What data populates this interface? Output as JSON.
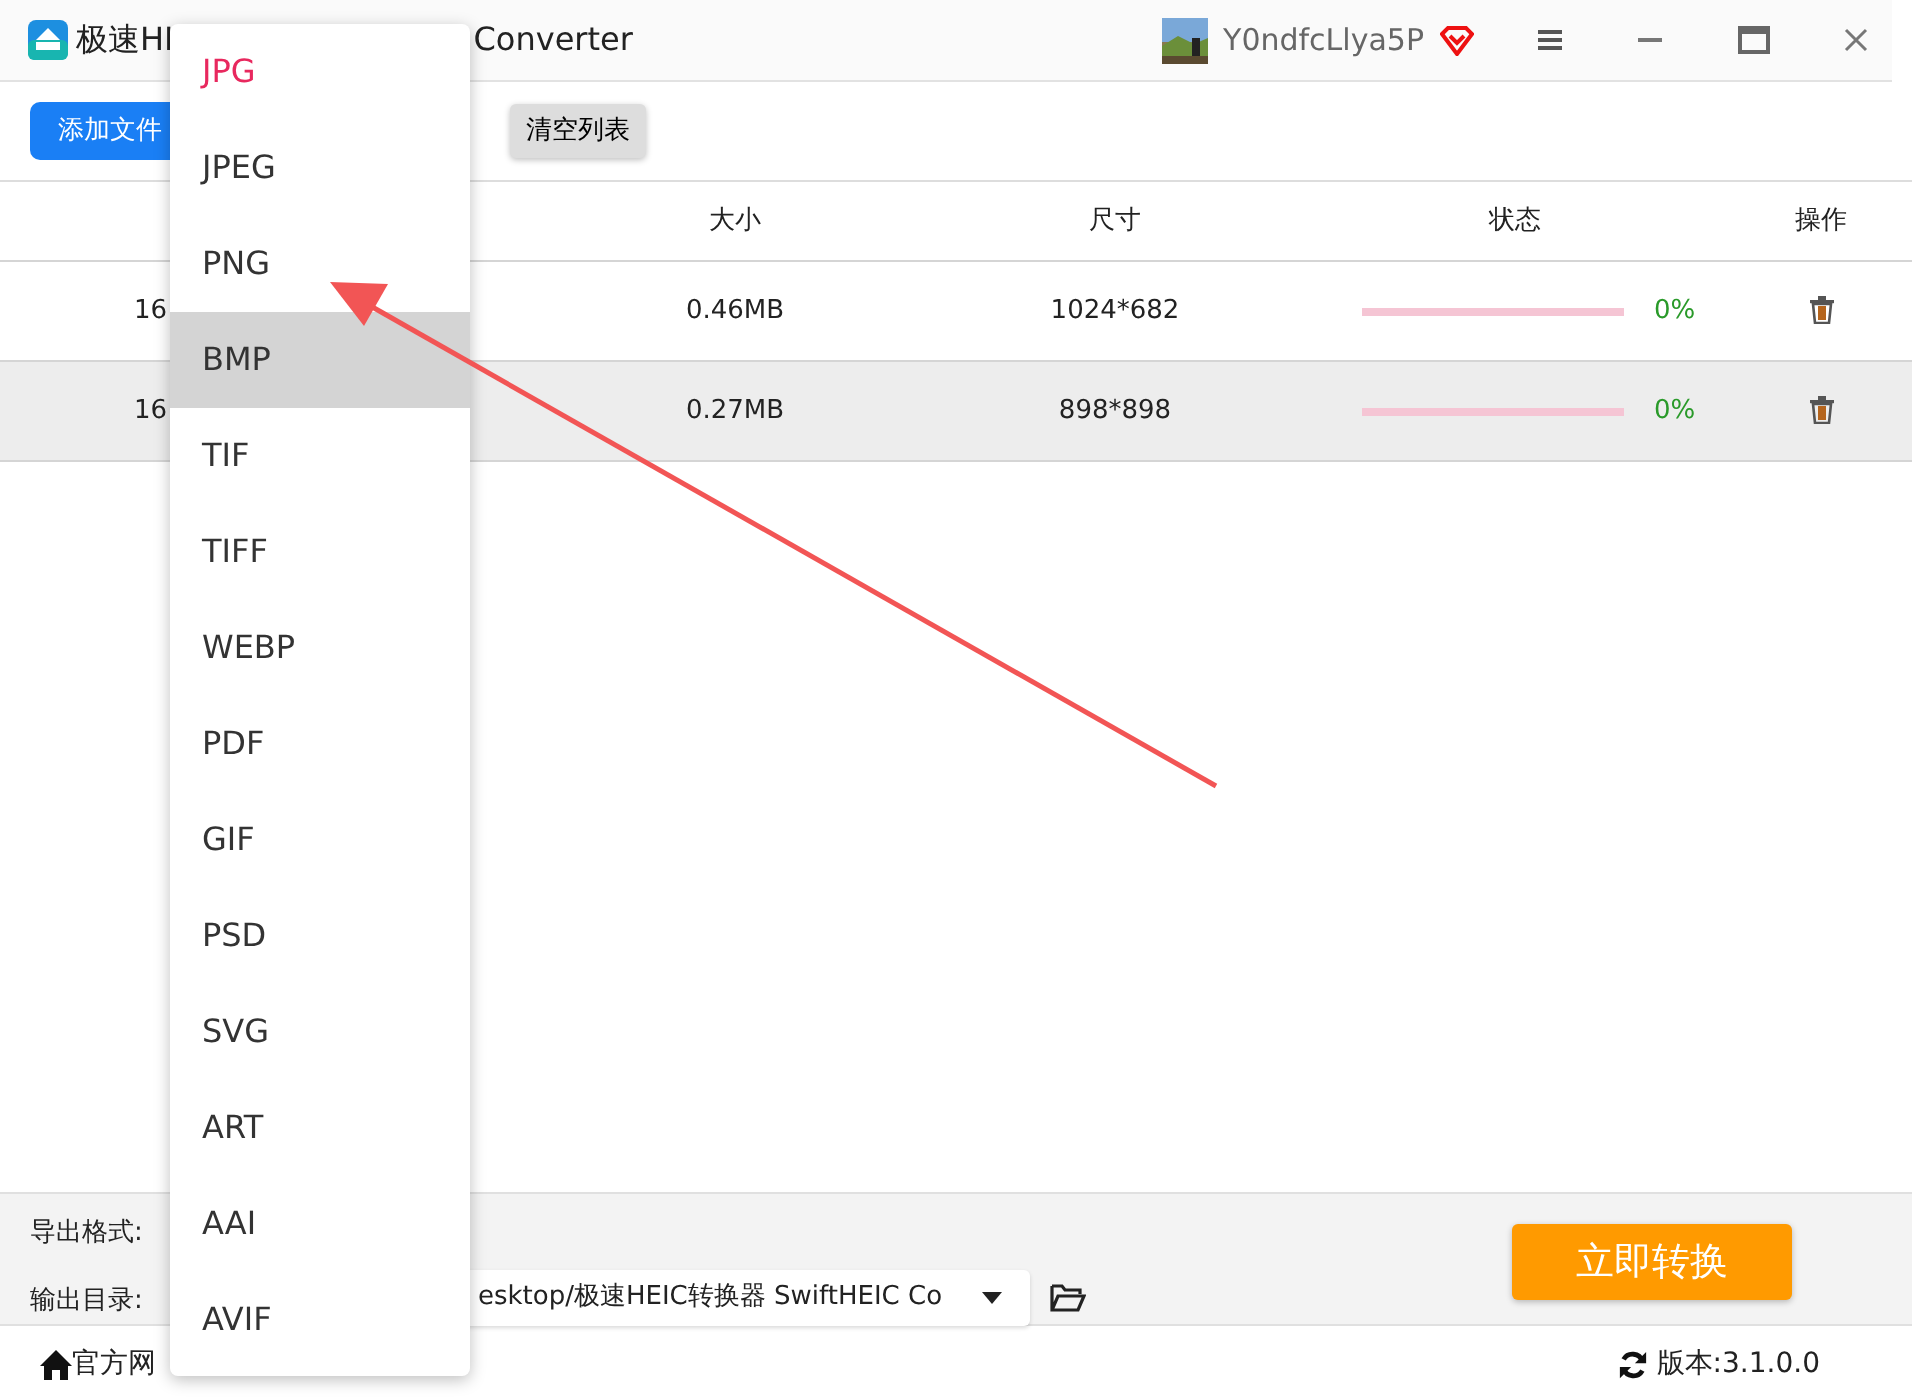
{
  "window": {
    "title_start": "极速HI",
    "title_end": "Converter",
    "user": "Y0ndfcLlya5P"
  },
  "toolbar": {
    "add_button": "添加文件",
    "clear_button": "清空列表"
  },
  "table": {
    "columns": [
      "大小",
      "尺寸",
      "状态",
      "操作"
    ],
    "rows": [
      {
        "name": "16",
        "size": "0.46MB",
        "dimensions": "1024*682",
        "level": 0,
        "percent": "0%",
        "selected": false
      },
      {
        "name": "16",
        "size": "0.27MB",
        "dimensions": "898*898",
        "level": 0,
        "percent": "0%",
        "selected": true
      }
    ]
  },
  "bottom": {
    "format_label": "导出格式:",
    "output_label": "输出目录:",
    "output_path": "esktop/极速HEIC转换器 SwiftHEIC Co",
    "convert_button": "立即转换"
  },
  "footer": {
    "website_link": "官方网",
    "version": "版本:3.1.0.0"
  },
  "format_menu": [
    {
      "label": "JPG",
      "selected": true,
      "highlighted": false
    },
    {
      "label": "JPEG",
      "selected": false,
      "highlighted": false
    },
    {
      "label": "PNG",
      "selected": false,
      "highlighted": false
    },
    {
      "label": "BMP",
      "selected": false,
      "highlighted": true
    },
    {
      "label": "TIF",
      "selected": false,
      "highlighted": false
    },
    {
      "label": "TIFF",
      "selected": false,
      "highlighted": false
    },
    {
      "label": "WEBP",
      "selected": false,
      "highlighted": false
    },
    {
      "label": "PDF",
      "selected": false,
      "highlighted": false
    },
    {
      "label": "GIF",
      "selected": false,
      "highlighted": false
    },
    {
      "label": "PSD",
      "selected": false,
      "highlighted": false
    },
    {
      "label": "SVG",
      "selected": false,
      "highlighted": false
    },
    {
      "label": "ART",
      "selected": false,
      "highlighted": false
    },
    {
      "label": "AAI",
      "selected": false,
      "highlighted": false
    },
    {
      "label": "AVIF",
      "selected": false,
      "highlighted": false
    }
  ]
}
